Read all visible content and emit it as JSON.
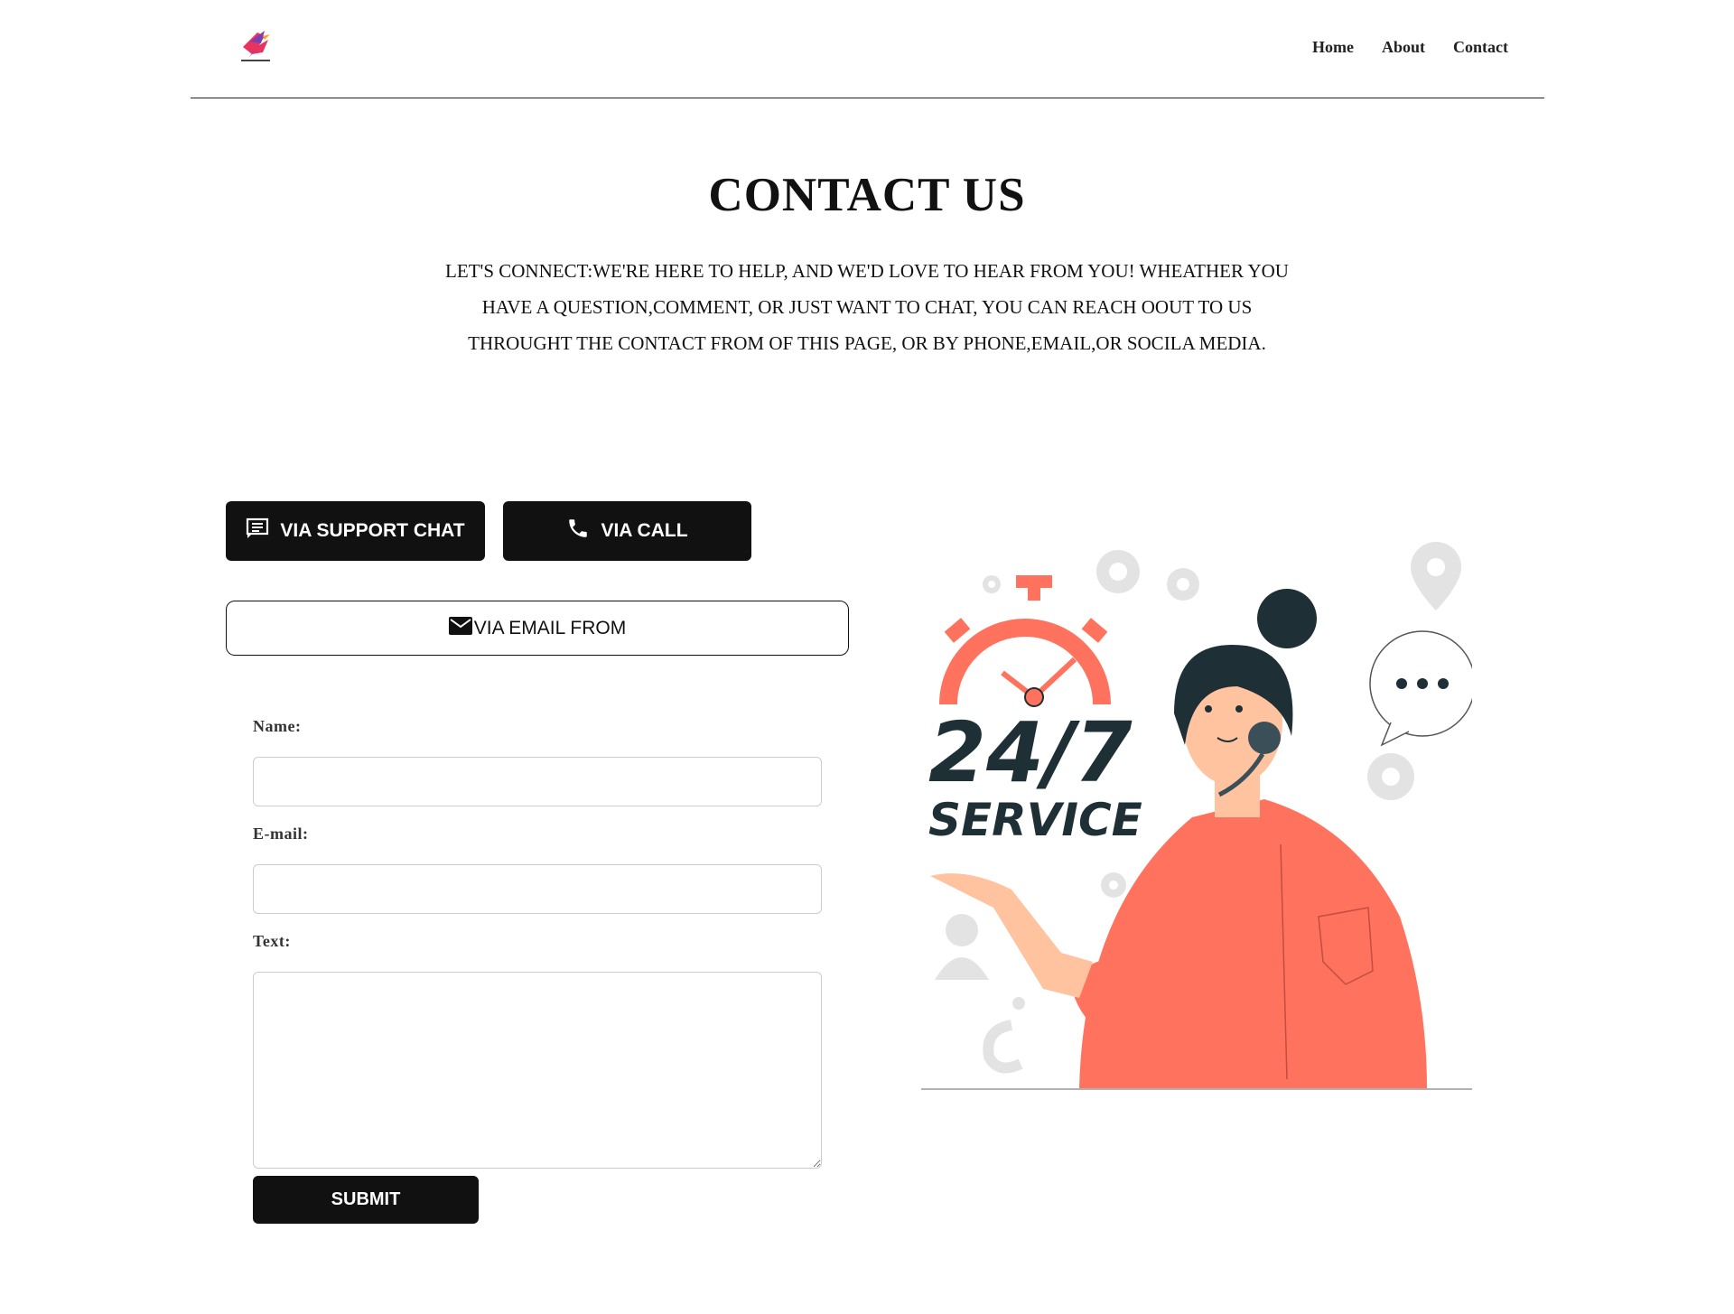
{
  "header": {
    "logo_icon": "bird-logo-icon",
    "nav": [
      {
        "label": "Home"
      },
      {
        "label": "About"
      },
      {
        "label": "Contact"
      }
    ]
  },
  "main": {
    "title": "CONTACT US",
    "intro": "LET'S CONNECT:WE'RE HERE TO HELP, AND WE'D LOVE TO HEAR FROM YOU! WHEATHER YOU HAVE A QUESTION,COMMENT, OR JUST WANT TO CHAT, YOU CAN REACH OOUT TO US THROUGHT THE CONTACT FROM OF THIS PAGE, OR BY PHONE,EMAIL,OR SOCILA MEDIA.",
    "buttons": {
      "chat": {
        "label": "VIA SUPPORT CHAT",
        "icon": "chat-icon"
      },
      "call": {
        "label": "VIA CALL",
        "icon": "phone-icon"
      },
      "email": {
        "label": "VIA EMAIL FROM",
        "icon": "mail-icon"
      }
    }
  },
  "form": {
    "name_label": "Name:",
    "name_value": "",
    "email_label": "E-mail:",
    "email_value": "",
    "text_label": "Text:",
    "text_value": "",
    "submit_label": "SUBMIT"
  },
  "illustration": {
    "big_text": "24/7",
    "sub_text": "SERVICE",
    "accent": "#ff725e",
    "dark": "#1f2f36"
  }
}
